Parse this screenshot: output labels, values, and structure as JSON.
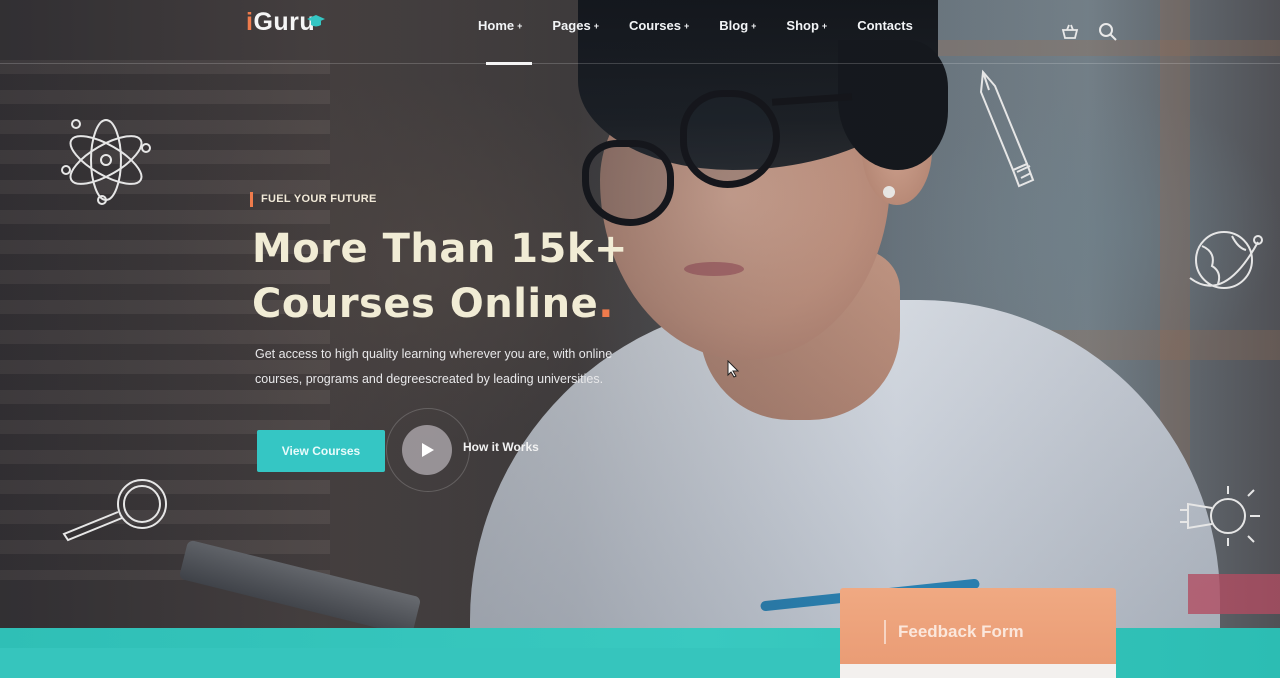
{
  "brand": {
    "logo_first": "i",
    "logo_rest": "Guru",
    "accent": "#ef7b4c",
    "teal": "#35c6c4"
  },
  "nav": {
    "items": [
      {
        "label": "Home",
        "active": true
      },
      {
        "label": "Pages",
        "active": false
      },
      {
        "label": "Courses",
        "active": false
      },
      {
        "label": "Blog",
        "active": false
      },
      {
        "label": "Shop",
        "active": false
      },
      {
        "label": "Contacts",
        "active": false
      }
    ],
    "icons": [
      "basket-icon",
      "search-icon"
    ]
  },
  "hero": {
    "eyebrow": "FUEL YOUR FUTURE",
    "title_line1": "More Than 15k+",
    "title_line2": "Courses Online",
    "title_dot": ".",
    "subtitle_line1": "Get access to high quality learning wherever you are, with online",
    "subtitle_line2": "courses, programs and degreescreated by leading universities.",
    "primary_button": "View Courses",
    "video_link": "How it Works"
  },
  "feedback": {
    "title": "Feedback Form"
  },
  "decorations": [
    "atom-icon",
    "pencil-icon",
    "globe-icon",
    "magnifier-icon",
    "lightbulb-icon"
  ]
}
